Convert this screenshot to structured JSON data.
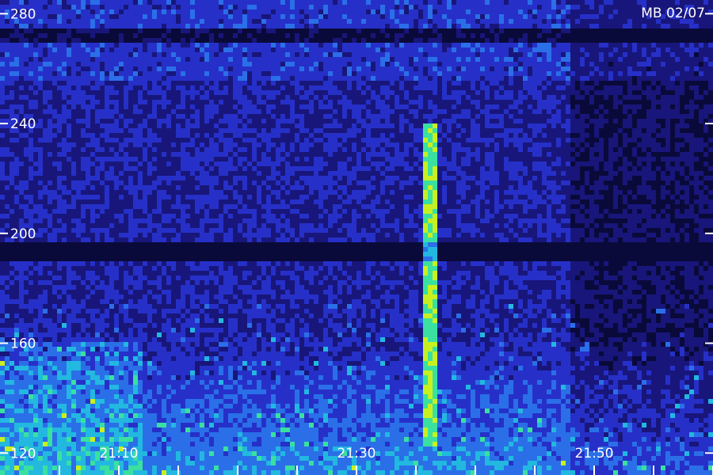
{
  "chart_data": {
    "type": "heatmap",
    "title": "",
    "xlabel": "",
    "ylabel": "",
    "annotation": "MB 02/07",
    "x_unit": "time",
    "x_ticks": [
      {
        "label": "21:10",
        "minutes": 0
      },
      {
        "label": "21:30",
        "minutes": 20
      },
      {
        "label": "21:50",
        "minutes": 40
      }
    ],
    "x_minor_minutes": [
      -5,
      0,
      5,
      10,
      15,
      20,
      25,
      30,
      35,
      40,
      45,
      50
    ],
    "xlim_minutes": [
      -10,
      50
    ],
    "y_ticks": [
      {
        "label": "120",
        "value": 120
      },
      {
        "label": "160",
        "value": 160
      },
      {
        "label": "200",
        "value": 200
      },
      {
        "label": "240",
        "value": 240
      },
      {
        "label": "280",
        "value": 280
      }
    ],
    "ylim": [
      112,
      285
    ],
    "grid": false,
    "colormap": [
      "#0a0a3a",
      "#18167a",
      "#2630c8",
      "#2a6fe8",
      "#22b8e0",
      "#3ae0a0",
      "#c8f020"
    ],
    "features": [
      {
        "type": "event",
        "t_min": 26.2,
        "y_from": 122,
        "y_to": 240,
        "intensity": 0.95
      },
      {
        "type": "dark_band",
        "y_from": 190,
        "y_to": 196
      },
      {
        "type": "dark_band",
        "y_from": 270,
        "y_to": 274
      },
      {
        "type": "noisy_region",
        "t_from": -10,
        "t_to": 2,
        "y_from": 112,
        "y_to": 160
      }
    ]
  }
}
